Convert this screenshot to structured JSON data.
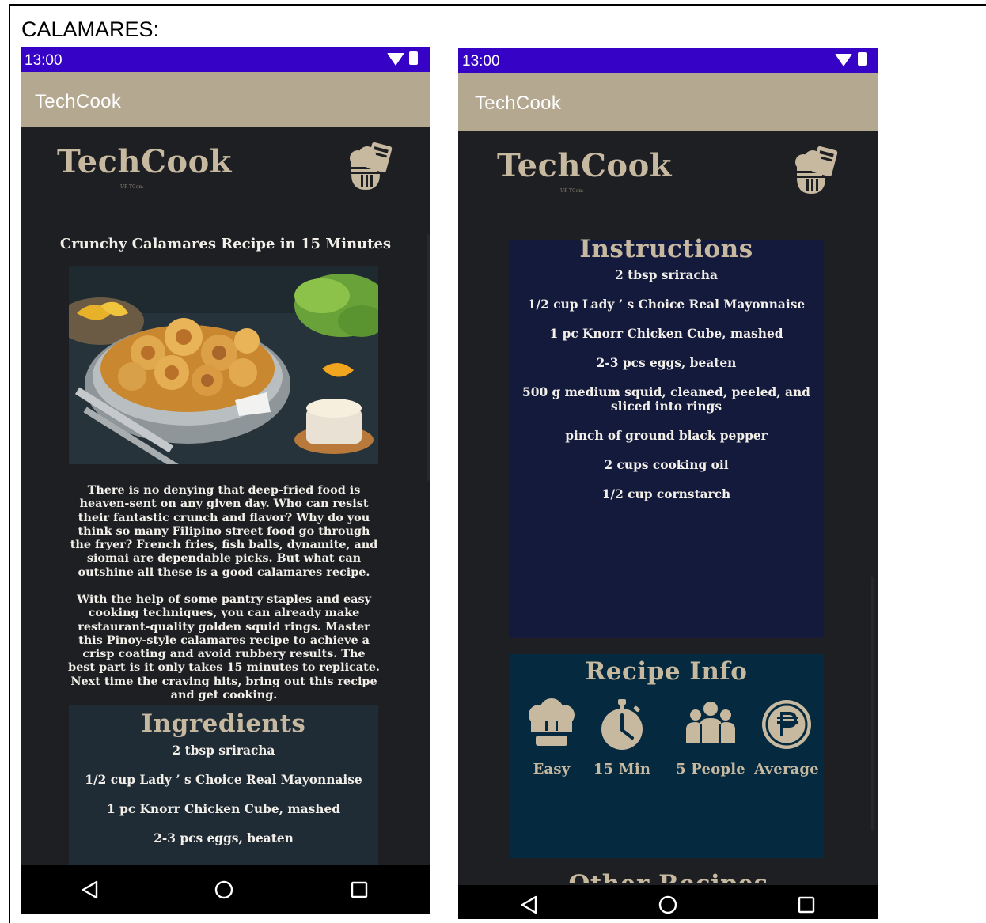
{
  "page": {
    "caption": "CALAMARES:"
  },
  "status_bar": {
    "time": "13:00"
  },
  "app_bar": {
    "title": "TechCook"
  },
  "logo": {
    "text": "TechCook",
    "tagline": "UP TCom"
  },
  "recipe": {
    "title": "Crunchy Calamares Recipe in 15 Minutes",
    "description_1": "There is no denying that deep-fried food is heaven-sent on any given day. Who can resist their fantastic crunch and flavor? Why do you think so many Filipino street food go through the fryer? French fries, fish balls, dynamite, and siomai are dependable picks. But what can outshine all these is a good calamares recipe.",
    "description_2": "With the help of some pantry staples and easy cooking techniques, you can already make restaurant-quality golden squid rings. Master this Pinoy-style calamares recipe to achieve a crisp coating and avoid rubbery results. The best part is it only takes 15 minutes to replicate. Next time the craving hits, bring out this recipe and get cooking."
  },
  "ingredients": {
    "title": "Ingredients",
    "items": [
      "2 tbsp sriracha",
      "1/2 cup Lady ’ s Choice Real Mayonnaise",
      "1 pc Knorr Chicken Cube, mashed",
      "2-3 pcs eggs, beaten"
    ]
  },
  "instructions": {
    "title": "Instructions",
    "items": [
      "2 tbsp sriracha",
      "1/2 cup Lady ’ s Choice Real Mayonnaise",
      "1 pc Knorr Chicken Cube, mashed",
      "2-3 pcs eggs, beaten",
      "500 g medium squid, cleaned, peeled, and sliced into rings",
      "pinch of ground black pepper",
      "2 cups cooking oil",
      "1/2 cup cornstarch"
    ]
  },
  "recipe_info": {
    "title": "Recipe Info",
    "items": [
      {
        "icon": "chef-hat-icon",
        "label": "Easy"
      },
      {
        "icon": "stopwatch-icon",
        "label": "15 Min"
      },
      {
        "icon": "people-icon",
        "label": "5 People"
      },
      {
        "icon": "peso-coin-icon",
        "label": "Average"
      }
    ]
  },
  "next_section": {
    "title": "Other Recipes"
  },
  "colors": {
    "status_bar": "#3602c6",
    "app_bar": "#b5a890",
    "background": "#1d1f22",
    "accent": "#c7b8a0",
    "ingredients_card": "#1f2b35",
    "instructions_card": "#141a3c",
    "info_card": "#05293f"
  }
}
